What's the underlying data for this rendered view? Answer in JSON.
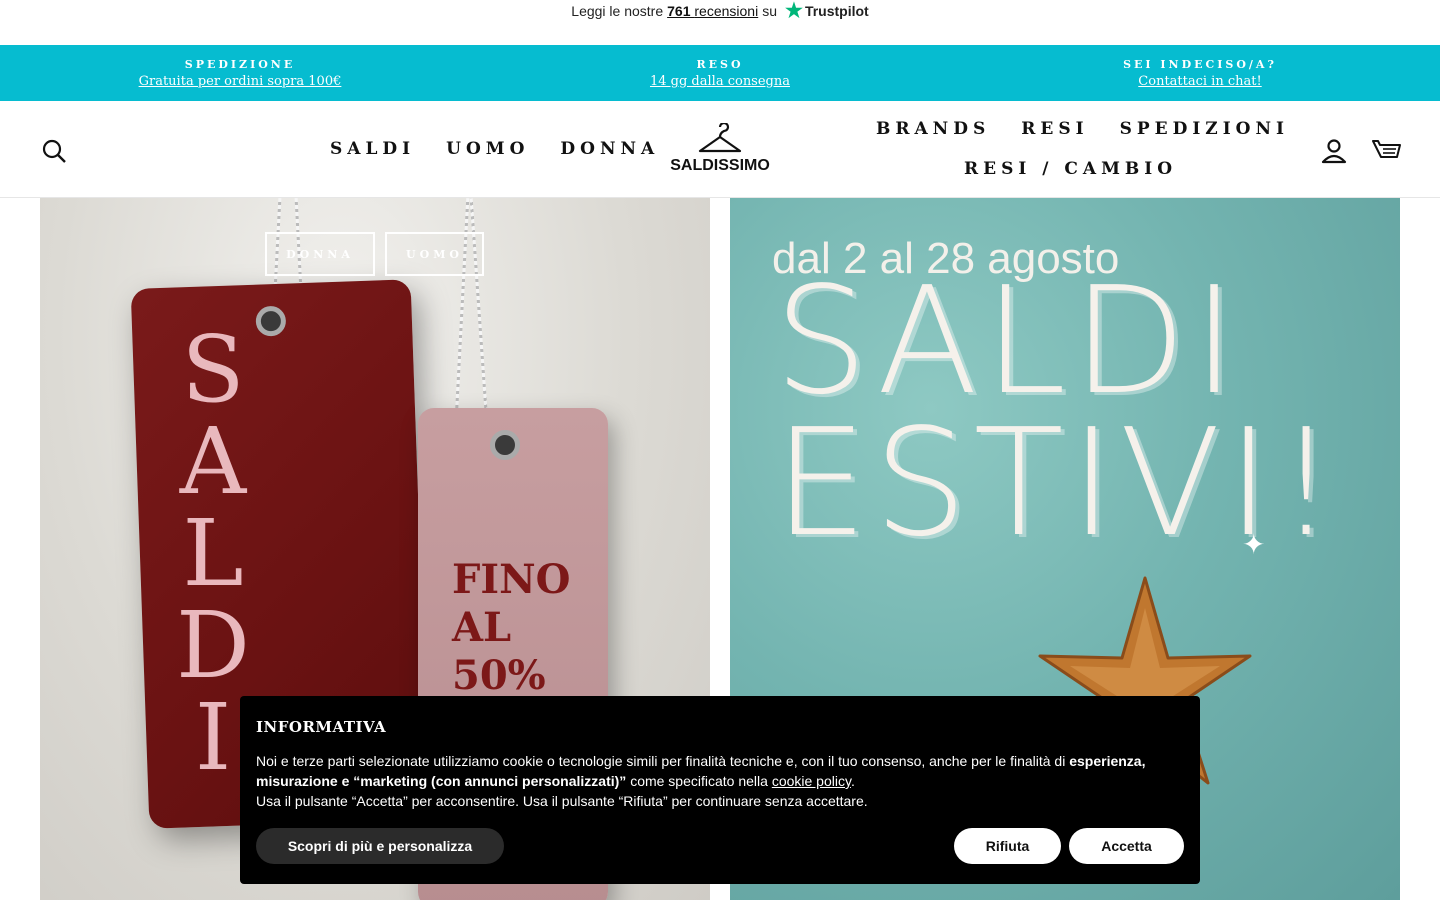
{
  "trustpilot": {
    "prefix": "Leggi le nostre",
    "count": "761",
    "reviews_label": "recensioni",
    "suffix": "su",
    "brand": "Trustpilot"
  },
  "announcement": [
    {
      "title": "SPEDIZIONE",
      "link": "Gratuita per ordini sopra 100€"
    },
    {
      "title": "RESO",
      "link": "14 gg dalla consegna"
    },
    {
      "title": "SEI INDECISO/A?",
      "link": "Contattaci in chat!"
    }
  ],
  "header": {
    "nav_left": [
      "SALDI",
      "UOMO",
      "DONNA"
    ],
    "logo_text": "SALDISSIMO",
    "nav_right_row1": [
      "BRANDS",
      "RESI",
      "SPEDIZIONI"
    ],
    "nav_right_row2": "RESI / CAMBIO"
  },
  "hero": {
    "left": {
      "buttons": [
        "DONNA",
        "UOMO"
      ],
      "tag_word_letters": [
        "S",
        "A",
        "L",
        "D",
        "I"
      ],
      "tag_small_lines": [
        "FINO",
        "AL",
        "50%"
      ]
    },
    "right": {
      "date_line": "dal 2 al 28 agosto",
      "headline_1": "SALDI",
      "headline_2": "ESTIVI!"
    }
  },
  "cookie": {
    "title": "INFORMATIVA",
    "text_1": "Noi e terze parti selezionate utilizziamo cookie o tecnologie simili per finalità tecniche e, con il tuo consenso, anche per le finalità di",
    "text_bold": "esperienza, misurazione e “marketing (con annunci personalizzati)”",
    "text_2": "come specificato nella",
    "policy_link": "cookie policy",
    "text_3": "Usa il pulsante “Accetta” per acconsentire. Usa il pulsante “Rifiuta” per continuare senza accettare.",
    "btn_more": "Scopri di più e personalizza",
    "btn_reject": "Rifiuta",
    "btn_accept": "Accetta"
  },
  "colors": {
    "announcement_bg": "#06bcd0",
    "trustpilot_star": "#00b67a",
    "cookie_bg": "#000000"
  }
}
